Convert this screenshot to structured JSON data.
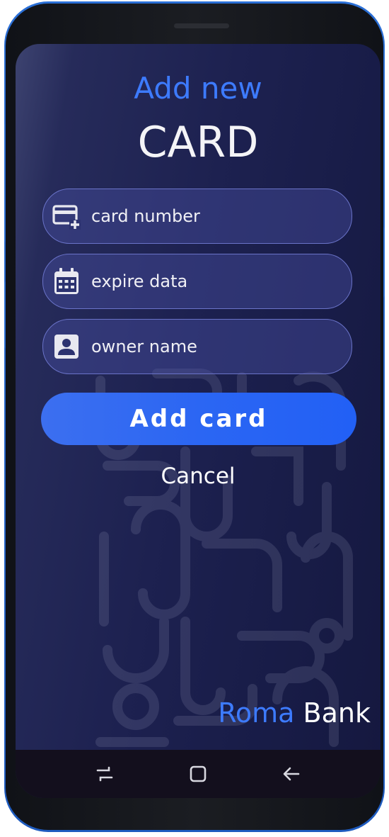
{
  "header": {
    "subtitle": "Add new",
    "title": "CARD"
  },
  "form": {
    "fields": [
      {
        "placeholder": "card number",
        "icon": "add-card-icon"
      },
      {
        "placeholder": "expire data",
        "icon": "calendar-icon"
      },
      {
        "placeholder": "owner name",
        "icon": "contact-icon"
      }
    ],
    "submit_label": "Add card",
    "cancel_label": "Cancel"
  },
  "brand": {
    "part1": "Roma",
    "part2": " Bank"
  },
  "navbar": {
    "items": [
      "recents-icon",
      "home-icon",
      "back-icon"
    ]
  },
  "colors": {
    "accent": "#3d7bff",
    "button": "#2b66f3",
    "background": "#1d2150",
    "phone_frame": "#2a6fd6"
  }
}
